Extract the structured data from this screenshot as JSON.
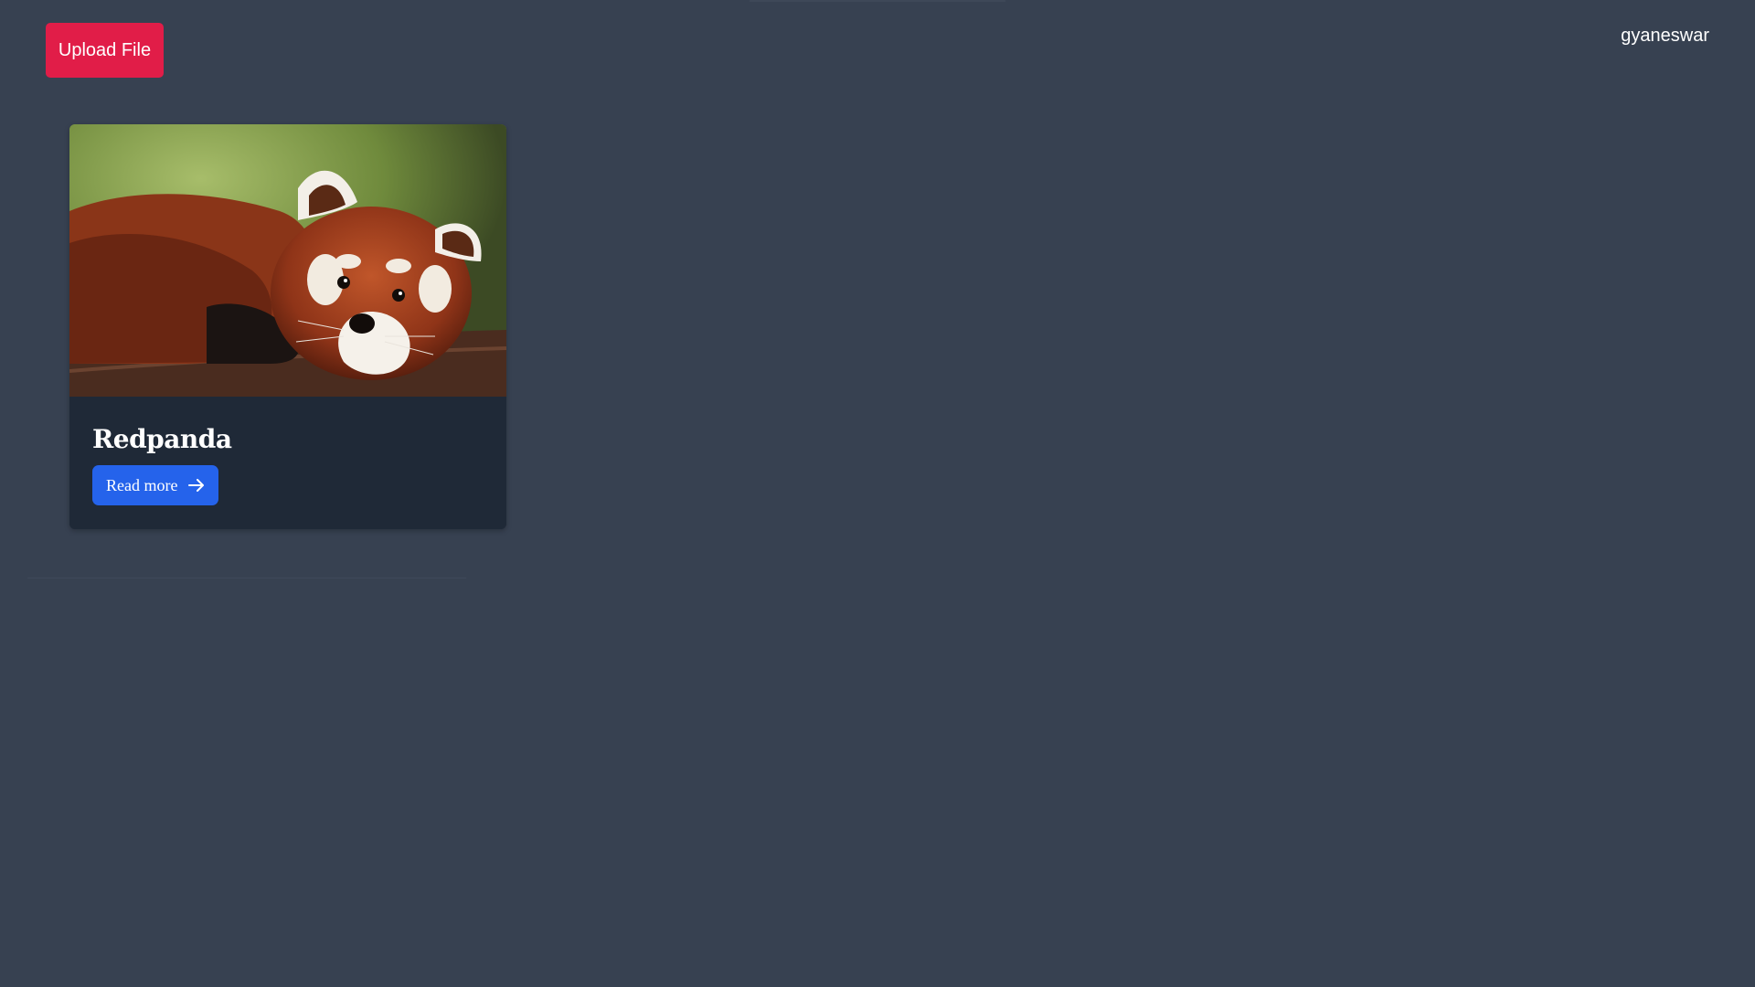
{
  "header": {
    "upload_button_label": "Upload File",
    "username": "gyaneswar"
  },
  "cards": [
    {
      "title": "Redpanda",
      "read_more_label": "Read more",
      "image_icon": "red-panda-photo",
      "button_icon": "arrow-right-icon"
    }
  ],
  "colors": {
    "background": "#374151",
    "upload_button": "#e11d48",
    "card_background": "#1f2937",
    "read_more_button": "#2563eb",
    "text": "#ffffff"
  }
}
